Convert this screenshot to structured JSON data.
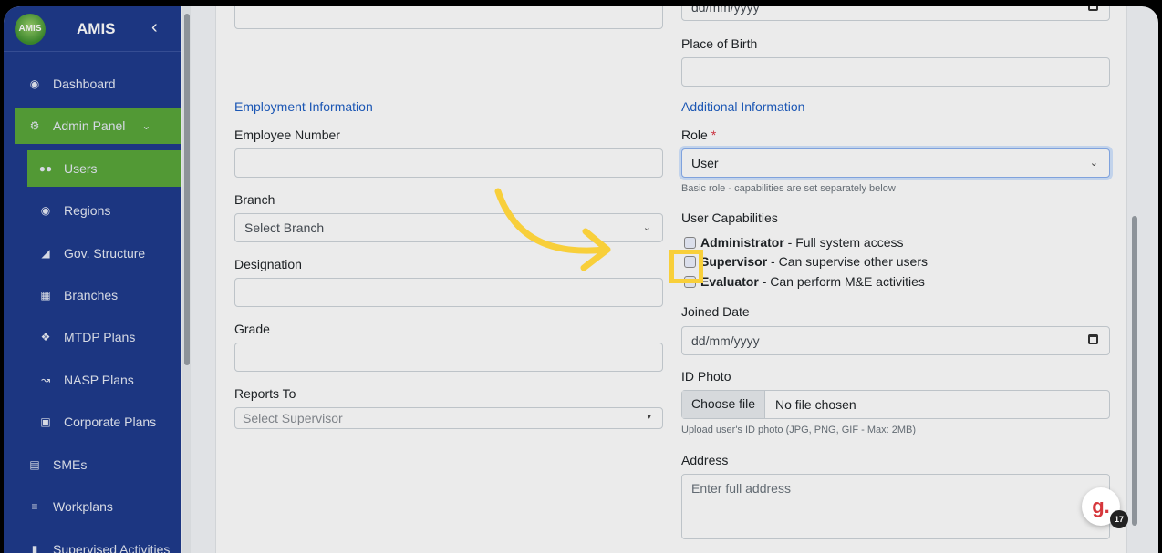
{
  "sidebar": {
    "logo_text": "AMIS",
    "title": "AMIS",
    "items": [
      {
        "label": "Dashboard",
        "icon": "dashboard-icon"
      },
      {
        "label": "Admin Panel",
        "icon": "gear-icon"
      },
      {
        "label": "Users",
        "icon": "users-icon"
      },
      {
        "label": "Regions",
        "icon": "map-pin-icon"
      },
      {
        "label": "Gov. Structure",
        "icon": "sitemap-icon"
      },
      {
        "label": "Branches",
        "icon": "building-icon"
      },
      {
        "label": "MTDP Plans",
        "icon": "signpost-icon"
      },
      {
        "label": "NASP Plans",
        "icon": "chart-line-icon"
      },
      {
        "label": "Corporate Plans",
        "icon": "briefcase-icon"
      },
      {
        "label": "SMEs",
        "icon": "store-icon"
      },
      {
        "label": "Workplans",
        "icon": "list-icon"
      },
      {
        "label": "Supervised Activities",
        "icon": "clipboard-icon"
      }
    ]
  },
  "form": {
    "top_date_placeholder": "dd/mm/yyyy",
    "place_of_birth_label": "Place of Birth",
    "employment_section": "Employment Information",
    "employee_number_label": "Employee Number",
    "branch_label": "Branch",
    "branch_value": "Select Branch",
    "designation_label": "Designation",
    "grade_label": "Grade",
    "reports_to_label": "Reports To",
    "reports_to_value": "Select Supervisor",
    "additional_section": "Additional Information",
    "role_label": "Role",
    "role_required": "*",
    "role_value": "User",
    "role_help": "Basic role - capabilities are set separately below",
    "capabilities_label": "User Capabilities",
    "capabilities": [
      {
        "name": "Administrator",
        "desc": " - Full system access"
      },
      {
        "name": "Supervisor",
        "desc": " - Can supervise other users"
      },
      {
        "name": "Evaluator",
        "desc": " - Can perform M&E activities"
      }
    ],
    "joined_date_label": "Joined Date",
    "joined_date_value": "dd/mm/yyyy",
    "id_photo_label": "ID Photo",
    "choose_file": "Choose file",
    "no_file": "No file chosen",
    "id_photo_help": "Upload user's ID photo (JPG, PNG, GIF - Max: 2MB)",
    "address_label": "Address",
    "address_placeholder": "Enter full address"
  },
  "widget": {
    "letter": "g.",
    "badge_count": "17"
  },
  "colors": {
    "sidebar": "#1f3b8c",
    "active": "#5aa63a",
    "highlight": "#f8cf3a",
    "section": "#1f5fc4"
  }
}
